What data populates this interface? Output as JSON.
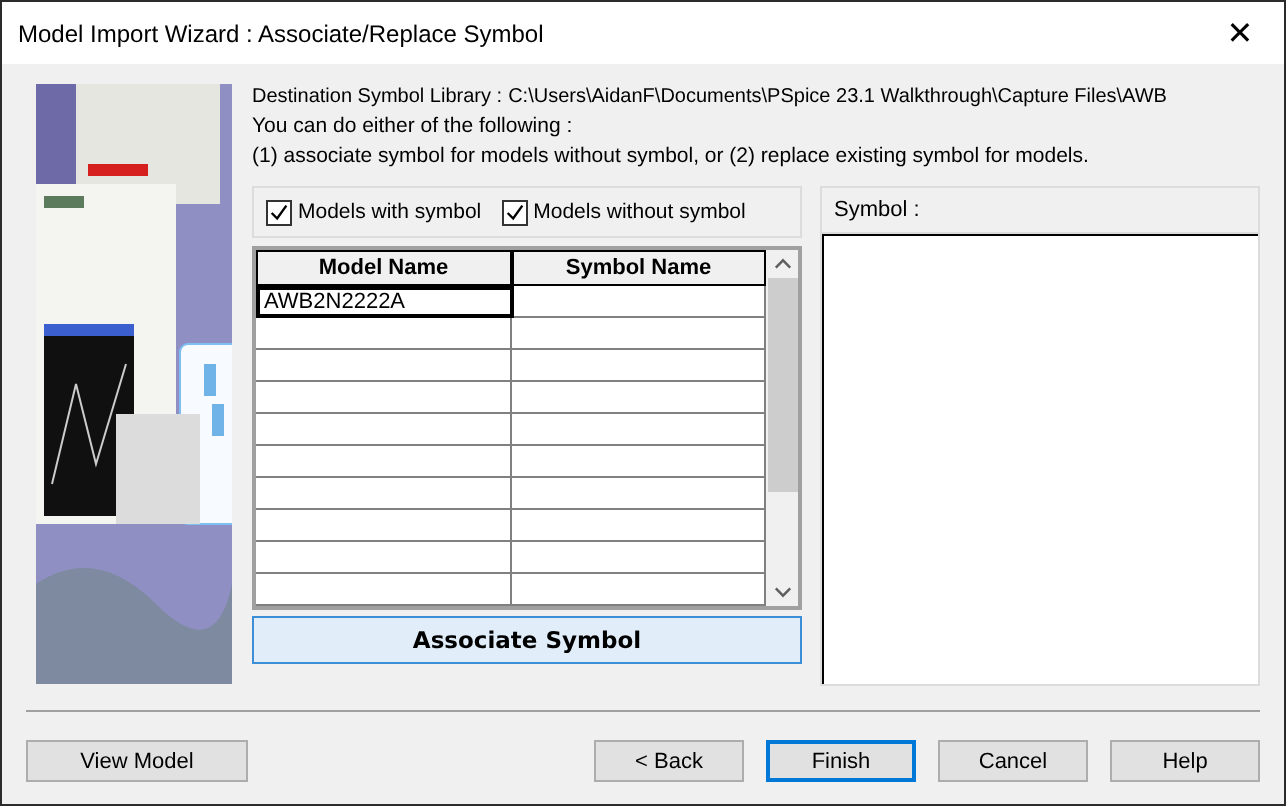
{
  "window": {
    "title": "Model Import Wizard : Associate/Replace Symbol",
    "close": "✕"
  },
  "destination": {
    "label": "Destination Symbol Library :",
    "path": "C:\\Users\\AidanF\\Documents\\PSpice 23.1 Walkthrough\\Capture Files\\AWB"
  },
  "instructions": [
    "You can do either of the following :",
    "(1) associate symbol for models without symbol, or (2) replace existing symbol for models."
  ],
  "filters": [
    {
      "label": "Models with symbol",
      "checked": true
    },
    {
      "label": "Models without symbol",
      "checked": true
    }
  ],
  "table": {
    "columns": [
      "Model Name",
      "Symbol Name"
    ],
    "rows": [
      {
        "model_name": "AWB2N2222A",
        "selected": true
      }
    ]
  },
  "associate_button": "Associate Symbol",
  "symbol_panel": {
    "label": "Symbol :"
  },
  "buttons": [
    {
      "label": "View Model",
      "kind": "left",
      "default": false
    },
    {
      "label": "< Back",
      "kind": "right",
      "default": false
    },
    {
      "label": "Finish",
      "kind": "right",
      "default": true
    },
    {
      "label": "Cancel",
      "kind": "right",
      "default": false
    },
    {
      "label": "Help",
      "kind": "right",
      "default": false
    }
  ]
}
